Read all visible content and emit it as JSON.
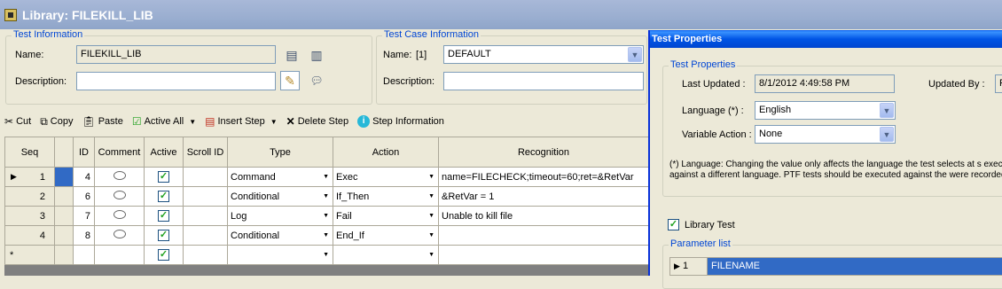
{
  "window": {
    "title": "Library: FILEKILL_LIB"
  },
  "test_info": {
    "group_label": "Test Information",
    "name_label": "Name:",
    "name_value": "FILEKILL_LIB",
    "description_label": "Description:",
    "description_value": ""
  },
  "test_case_info": {
    "group_label": "Test Case Information",
    "name_label": "Name:",
    "index": "[1]",
    "name_value": "DEFAULT",
    "description_label": "Description:",
    "description_value": ""
  },
  "toolbar": {
    "cut": "Cut",
    "copy": "Copy",
    "paste": "Paste",
    "active_all": "Active All",
    "insert_step": "Insert Step",
    "delete_step": "Delete Step",
    "step_information": "Step Information"
  },
  "grid": {
    "columns": [
      "Seq",
      "ID",
      "Comment",
      "Active",
      "Scroll ID",
      "Type",
      "Action",
      "Recognition"
    ],
    "rows": [
      {
        "seq": "1",
        "id": "4",
        "type": "Command",
        "action": "Exec",
        "recognition": "name=FILECHECK;timeout=60;ret=&RetVar"
      },
      {
        "seq": "2",
        "id": "6",
        "type": "Conditional",
        "action": "If_Then",
        "recognition": "&RetVar = 1"
      },
      {
        "seq": "3",
        "id": "7",
        "type": "Log",
        "action": "Fail",
        "recognition": "Unable to kill file"
      },
      {
        "seq": "4",
        "id": "8",
        "type": "Conditional",
        "action": "End_If",
        "recognition": ""
      }
    ],
    "new_row_marker": "*"
  },
  "test_properties": {
    "title": "Test Properties",
    "group_label": "Test Properties",
    "last_updated_label": "Last Updated :",
    "last_updated_value": "8/1/2012 4:49:58 PM",
    "updated_by_label": "Updated By :",
    "updated_by_value": "F",
    "language_label": "Language (*) :",
    "language_value": "English",
    "variable_action_label": "Variable Action :",
    "variable_action_value": "None",
    "note": "(*) Language: Changing the value only affects the language the test selects at s execute against a different language. PTF tests should be executed against the were recorded.",
    "library_test_label": "Library Test",
    "parameter_list_label": "Parameter list",
    "parameter_row_num": "1",
    "parameter_value": "FILENAME"
  }
}
